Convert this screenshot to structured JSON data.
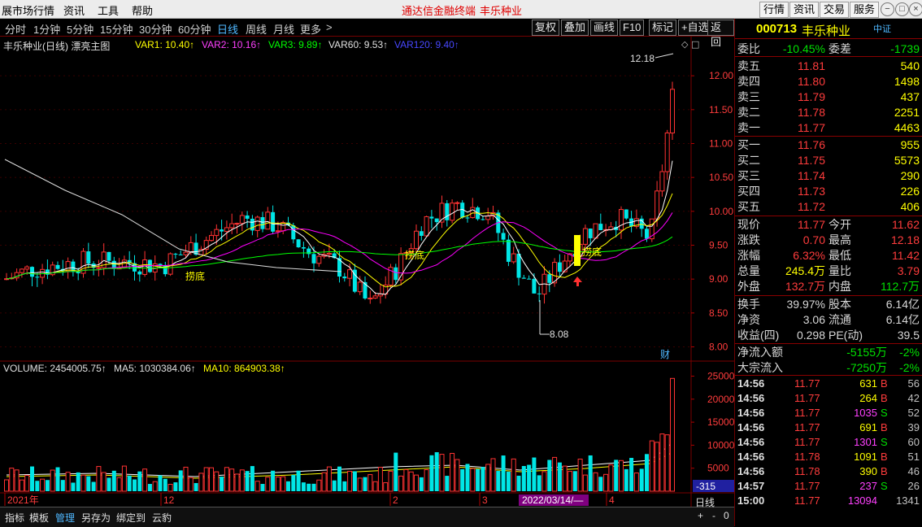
{
  "menu": {
    "items": [
      "展市场行情",
      "资讯",
      "工具",
      "帮助"
    ],
    "title_app": "通达信金融终端",
    "title_stock": "丰乐种业",
    "right_buttons": [
      "行情",
      "资讯",
      "交易",
      "服务"
    ],
    "win_icons": [
      "−",
      "□",
      "×"
    ]
  },
  "periods": [
    "分时",
    "1分钟",
    "5分钟",
    "15分钟",
    "30分钟",
    "60分钟",
    "日线",
    "周线",
    "月线",
    "更多",
    ">"
  ],
  "active_period": "日线",
  "toolbar": [
    "复权",
    "叠加",
    "画线",
    "F10",
    "标记",
    "+自选",
    "返回"
  ],
  "toolbar_extra": "◇ □",
  "indicators": {
    "title": "丰乐种业(日线) 漂亮主图",
    "var1": "VAR1: 10.40↑",
    "var2": "VAR2: 10.16↑",
    "var3": "VAR3: 9.89↑",
    "var60": "VAR60: 9.53↑",
    "var120": "VAR120: 9.40↑"
  },
  "volume_indicators": {
    "volume": "VOLUME: 2454005.75↑",
    "ma5": "MA5: 1030384.06↑",
    "ma10": "MA10: 864903.38↑"
  },
  "price_axis": [
    "12.00",
    "11.50",
    "11.00",
    "10.50",
    "10.00",
    "9.50",
    "9.00",
    "8.50",
    "8.00"
  ],
  "volume_axis": [
    "25000",
    "20000",
    "15000",
    "10000",
    "5000"
  ],
  "volume_unit": "-315",
  "x_labels": [
    "2021年",
    "12",
    "2",
    "3",
    "4"
  ],
  "date_marker": "2022/03/14/—",
  "max_label": "12.18",
  "min_label": "8.08",
  "chart_tags": [
    "捞底",
    "捞底",
    "捞底"
  ],
  "cai_label": "财",
  "period_label": "日线",
  "zoom_buttons": [
    "+",
    "-",
    "0"
  ],
  "colors": {
    "up": "#ff3232",
    "down": "#00e6e6",
    "ma_white": "#ffffff",
    "ma_yellow": "#ffff00",
    "ma_magenta": "#ff00ff",
    "ma_green": "#00ff00",
    "ma_blue": "#4040ff",
    "grid": "#7a0000"
  },
  "stock": {
    "code": "000713",
    "name": "丰乐种业",
    "tag": "中证"
  },
  "quote_top": [
    {
      "l": "委比",
      "v": "-10.45%",
      "l2": "委差",
      "v2": "-1739"
    }
  ],
  "asks": [
    {
      "label": "卖五",
      "price": "11.81",
      "vol": "540"
    },
    {
      "label": "卖四",
      "price": "11.80",
      "vol": "1498"
    },
    {
      "label": "卖三",
      "price": "11.79",
      "vol": "437"
    },
    {
      "label": "卖二",
      "price": "11.78",
      "vol": "2251"
    },
    {
      "label": "卖一",
      "price": "11.77",
      "vol": "4463"
    }
  ],
  "bids": [
    {
      "label": "买一",
      "price": "11.76",
      "vol": "955"
    },
    {
      "label": "买二",
      "price": "11.75",
      "vol": "5573"
    },
    {
      "label": "买三",
      "price": "11.74",
      "vol": "290"
    },
    {
      "label": "买四",
      "price": "11.73",
      "vol": "226"
    },
    {
      "label": "买五",
      "price": "11.72",
      "vol": "406"
    }
  ],
  "stats1": [
    {
      "l": "现价",
      "v": "11.77",
      "l2": "今开",
      "v2": "11.62"
    },
    {
      "l": "涨跌",
      "v": "0.70",
      "l2": "最高",
      "v2": "12.18"
    },
    {
      "l": "涨幅",
      "v": "6.32%",
      "l2": "最低",
      "v2": "11.42"
    },
    {
      "l": "总量",
      "v": "245.4万",
      "l2": "量比",
      "v2": "3.79"
    },
    {
      "l": "外盘",
      "v": "132.7万",
      "l2": "内盘",
      "v2": "112.7万"
    }
  ],
  "stats2": [
    {
      "l": "换手",
      "v": "39.97%",
      "l2": "股本",
      "v2": "6.14亿"
    },
    {
      "l": "净资",
      "v": "3.06",
      "l2": "流通",
      "v2": "6.14亿"
    },
    {
      "l": "收益(四)",
      "v": "0.298",
      "l2": "PE(动)",
      "v2": "39.5"
    }
  ],
  "flows": [
    {
      "l": "净流入额",
      "v": "-5155万",
      "p": "-2%"
    },
    {
      "l": "大宗流入",
      "v": "-7250万",
      "p": "-2%"
    }
  ],
  "ticks": [
    {
      "t": "14:56",
      "p": "11.77",
      "v": "631",
      "bs": "B",
      "n": "56"
    },
    {
      "t": "14:56",
      "p": "11.77",
      "v": "264",
      "bs": "B",
      "n": "42"
    },
    {
      "t": "14:56",
      "p": "11.77",
      "v": "1035",
      "bs": "S",
      "n": "52"
    },
    {
      "t": "14:56",
      "p": "11.77",
      "v": "691",
      "bs": "B",
      "n": "39"
    },
    {
      "t": "14:56",
      "p": "11.77",
      "v": "1301",
      "bs": "S",
      "n": "60"
    },
    {
      "t": "14:56",
      "p": "11.78",
      "v": "1091",
      "bs": "B",
      "n": "51"
    },
    {
      "t": "14:56",
      "p": "11.78",
      "v": "390",
      "bs": "B",
      "n": "46"
    },
    {
      "t": "14:57",
      "p": "11.77",
      "v": "237",
      "bs": "S",
      "n": "26"
    },
    {
      "t": "15:00",
      "p": "11.77",
      "v": "13094",
      "bs": "",
      "n": "1341"
    }
  ],
  "bottom_tabs": [
    "指标",
    "模板",
    "管理",
    "另存为",
    "绑定到",
    "云豹"
  ],
  "active_bottom_tab": "管理"
}
